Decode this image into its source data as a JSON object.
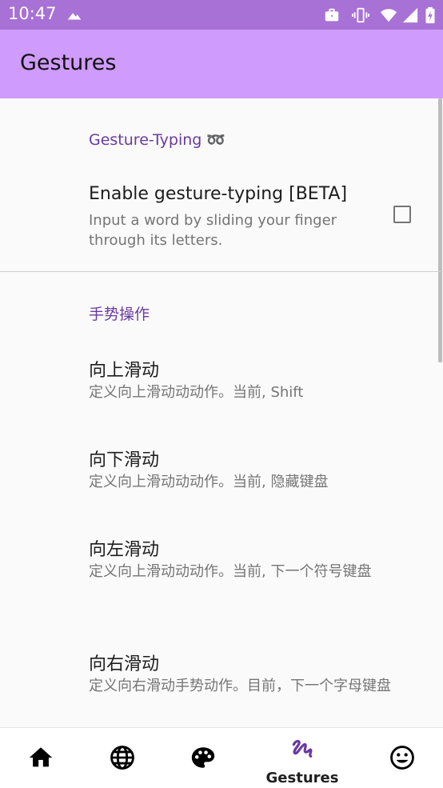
{
  "status_bar": {
    "time": "10:47",
    "icons": [
      "cloud-notification-icon",
      "briefcase-icon",
      "vibrate-icon",
      "wifi-icon",
      "signal-icon",
      "battery-charging-icon"
    ]
  },
  "app_bar": {
    "title": "Gestures"
  },
  "sections": [
    {
      "header": "Gesture-Typing ➿",
      "prefs": [
        {
          "title": "Enable gesture-typing [BETA]",
          "summary": "Input a word by sliding your finger through its letters.",
          "checked": false
        }
      ]
    },
    {
      "header": "手势操作",
      "prefs": [
        {
          "title": "向上滑动",
          "summary": "定义向上滑动动动作。当前, Shift"
        },
        {
          "title": "向下滑动",
          "summary": "定义向上滑动动动作。当前, 隐藏键盘"
        },
        {
          "title": "向左滑动",
          "summary": "定义向上滑动动动作。当前, 下一个符号键盘"
        },
        {
          "title": "向右滑动",
          "summary": "定义向右滑动手势动作。目前，下一个字母键盘"
        }
      ]
    }
  ],
  "bottom_nav": {
    "items": [
      {
        "icon": "home-icon",
        "label": ""
      },
      {
        "icon": "globe-icon",
        "label": ""
      },
      {
        "icon": "palette-icon",
        "label": ""
      },
      {
        "icon": "gesture-icon",
        "label": "Gestures",
        "active": true
      },
      {
        "icon": "emoji-icon",
        "label": ""
      }
    ]
  },
  "colors": {
    "status_bar": "#a871d6",
    "app_bar": "#cf9bfc",
    "accent": "#6a3aa0",
    "active_nav": "#6a3aa0"
  }
}
